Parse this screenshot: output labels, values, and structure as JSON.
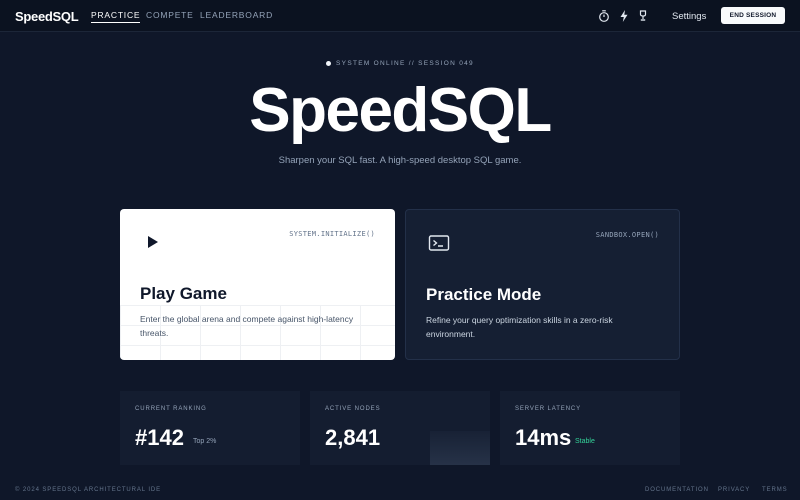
{
  "app": {
    "logo": "SpeedSQL"
  },
  "nav": {
    "tabs": [
      {
        "label": "PRACTICE",
        "active": true
      },
      {
        "label": "COMPETE",
        "active": false
      },
      {
        "label": "LEADERBOARD",
        "active": false
      }
    ],
    "icons": [
      "timer-icon",
      "bolt-icon",
      "trophy-icon"
    ],
    "settings_label": "Settings",
    "end_session_label": "END SESSION"
  },
  "hero": {
    "status": "SYSTEM ONLINE // SESSION 049",
    "title": "SpeedSQL",
    "tagline": "Sharpen your SQL fast. A high-speed desktop SQL game."
  },
  "cards": [
    {
      "icon": "play-icon",
      "code": "SYSTEM.INITIALIZE()",
      "title": "Play Game",
      "description": "Enter the global arena and compete against high-latency threats."
    },
    {
      "icon": "terminal-icon",
      "code": "SANDBOX.OPEN()",
      "title": "Practice Mode",
      "description": "Refine your query optimization skills in a zero-risk environment."
    }
  ],
  "stats": [
    {
      "label": "CURRENT RANKING",
      "value": "#142",
      "sub": "Top 2%"
    },
    {
      "label": "ACTIVE NODES",
      "value": "2,841",
      "sub": ""
    },
    {
      "label": "SERVER LATENCY",
      "value": "14ms",
      "sub": "Stable"
    }
  ],
  "footer": {
    "copyright": "© 2024 SPEEDSQL ARCHITECTURAL IDE",
    "links": [
      "DOCUMENTATION",
      "PRIVACY",
      "TERMS"
    ]
  },
  "colors": {
    "background": "#0f1729",
    "topbar": "#0b1220",
    "card_dark": "#151f33",
    "stat_bg": "#141d30",
    "accent_green": "#34d399"
  }
}
